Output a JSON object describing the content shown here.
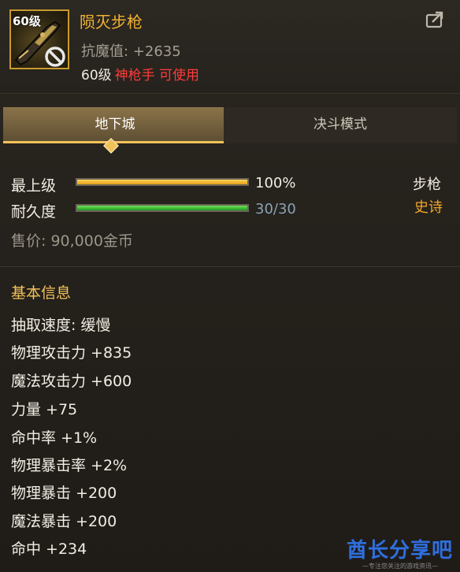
{
  "item": {
    "level_badge": "60级",
    "name": "陨灭步枪",
    "resist": "抗魔值: +2635",
    "req_level": "60级",
    "req_class": "神枪手 可使用"
  },
  "tabs": [
    "地下城",
    "决斗模式"
  ],
  "stats": {
    "grade_label": "最上级",
    "grade_value": "100%",
    "grade_fraction": 1.0,
    "durability_label": "耐久度",
    "durability_value": "30/30",
    "durability_fraction": 1.0,
    "type": "步枪",
    "rarity": "史诗",
    "price": "售价: 90,000金币"
  },
  "basic": {
    "title": "基本信息",
    "attributes": [
      "抽取速度: 缓慢",
      "物理攻击力 +835",
      "魔法攻击力 +600",
      "力量 +75",
      "命中率 +1%",
      "物理暴击率 +2%",
      "物理暴击 +200",
      "魔法暴击 +200",
      "命中 +234"
    ]
  },
  "watermark": {
    "brand": "酋长分享吧",
    "tagline": "—专注您关注的游戏资讯—"
  },
  "colors": {
    "item_name": "#f0b232",
    "class_req": "#ff3b3b",
    "rarity": "#f0a62a",
    "section_title": "#f2c25a",
    "watermark": "#2f6fe0"
  },
  "icons": [
    "weapon-rifle-icon",
    "prohibited-icon",
    "share-icon",
    "tab-marker-diamond-icon"
  ]
}
